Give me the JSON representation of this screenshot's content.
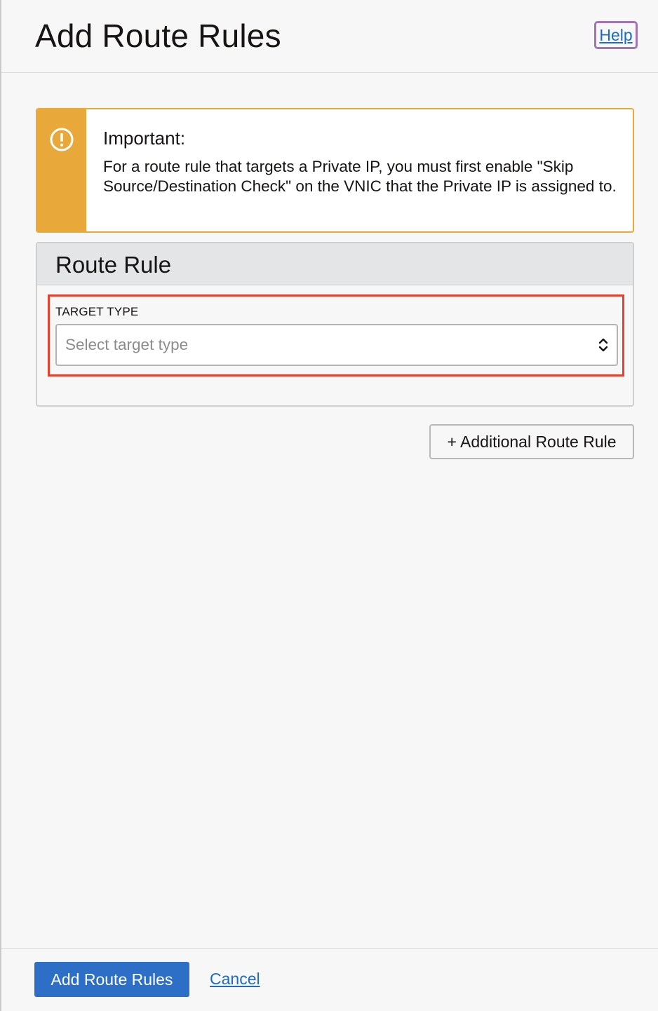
{
  "header": {
    "title": "Add Route Rules",
    "help_label": "Help"
  },
  "alert": {
    "icon": "exclamation-circle-icon",
    "title": "Important:",
    "body": "For a route rule that targets a Private IP, you must first enable \"Skip Source/Destination Check\" on the VNIC that the Private IP is assigned to."
  },
  "route_rule": {
    "title": "Route Rule",
    "target_type": {
      "label": "TARGET TYPE",
      "placeholder": "Select target type",
      "icon": "select-chevrons-icon"
    }
  },
  "actions": {
    "additional_rule_label": "+ Additional Route Rule"
  },
  "footer": {
    "submit_label": "Add Route Rules",
    "cancel_label": "Cancel"
  },
  "colors": {
    "alert_accent": "#e8a93a",
    "primary_button": "#2d6fc7",
    "link": "#1e6dbd",
    "highlight_border": "#e5432f",
    "help_focus_ring": "#a274b2"
  }
}
